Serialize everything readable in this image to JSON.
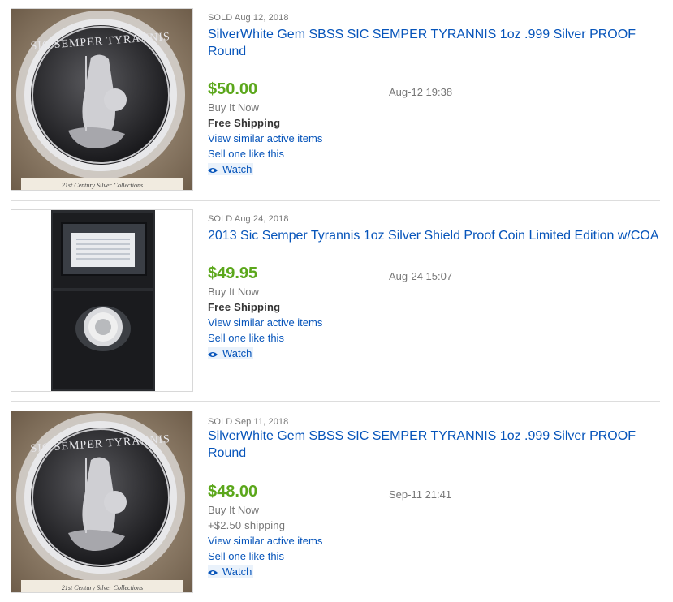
{
  "listings": [
    {
      "sold_label": "SOLD Aug 12, 2018",
      "title": "SilverWhite Gem SBSS SIC SEMPER TYRANNIS 1oz .999 Silver PROOF Round",
      "price": "$50.00",
      "end_time": "Aug-12 19:38",
      "format": "Buy It Now",
      "shipping": "Free Shipping",
      "view_similar": "View similar active items",
      "sell_one": "Sell one like this",
      "watch": "Watch",
      "image": {
        "coin_text_top": "SIC SEMPER TYRANNIS",
        "caption": "21st Century Silver Collections"
      }
    },
    {
      "sold_label": "SOLD Aug 24, 2018",
      "title": "2013 Sic Semper Tyrannis 1oz Silver Shield Proof Coin Limited Edition w/COA",
      "price": "$49.95",
      "end_time": "Aug-24 15:07",
      "format": "Buy It Now",
      "shipping": "Free Shipping",
      "view_similar": "View similar active items",
      "sell_one": "Sell one like this",
      "watch": "Watch"
    },
    {
      "sold_label": "SOLD Sep 11, 2018",
      "title": "SilverWhite Gem SBSS SIC SEMPER TYRANNIS 1oz .999 Silver PROOF Round",
      "price": "$48.00",
      "end_time": "Sep-11 21:41",
      "format": "Buy It Now",
      "shipping": "+$2.50 shipping",
      "view_similar": "View similar active items",
      "sell_one": "Sell one like this",
      "watch": "Watch",
      "image": {
        "coin_text_top": "SIC SEMPER TYRANNIS",
        "caption": "21st Century Silver Collections"
      }
    }
  ],
  "colors": {
    "link": "#0654ba",
    "price": "#5ba71b",
    "muted": "#767676"
  },
  "icons": {
    "watch": "eye-icon"
  }
}
